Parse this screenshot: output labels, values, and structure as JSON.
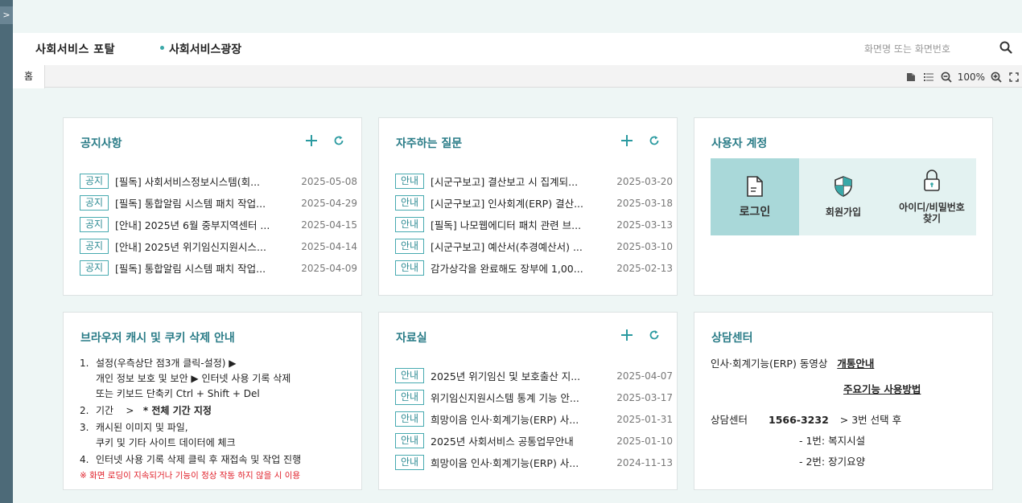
{
  "sidebar": {
    "toggle_icon": "chevron-right-icon",
    "toggle_label": ">"
  },
  "header": {
    "portal_title": "사회서비스 포탈",
    "menu_plaza": "사회서비스광장",
    "search_placeholder": "화면명 또는 화면번호",
    "search_icon": "search-icon"
  },
  "tabs": {
    "home": "홈",
    "zoom": "100%"
  },
  "notices": {
    "title": "공지사항",
    "items": [
      {
        "badge": "공지",
        "title": "[필독] 사회서비스정보시스템(회...",
        "date": "2025-05-08"
      },
      {
        "badge": "공지",
        "title": "[필독] 통합알림 시스템 패치 작업...",
        "date": "2025-04-29"
      },
      {
        "badge": "공지",
        "title": "[안내] 2025년 6월 중부지역센터 ...",
        "date": "2025-04-15"
      },
      {
        "badge": "공지",
        "title": "[안내] 2025년 위기임신지원시스...",
        "date": "2025-04-14"
      },
      {
        "badge": "공지",
        "title": "[필독] 통합알림 시스템 패치 작업...",
        "date": "2025-04-09"
      }
    ]
  },
  "faq": {
    "title": "자주하는 질문",
    "items": [
      {
        "badge": "안내",
        "title": "[시군구보고] 결산보고 시 집계되...",
        "date": "2025-03-20"
      },
      {
        "badge": "안내",
        "title": "[시군구보고] 인사회계(ERP) 결산...",
        "date": "2025-03-18"
      },
      {
        "badge": "안내",
        "title": "[필독] 나모웹에디터 패치 관련 브...",
        "date": "2025-03-13"
      },
      {
        "badge": "안내",
        "title": "[시군구보고] 예산서(추경예산서) ...",
        "date": "2025-03-10"
      },
      {
        "badge": "안내",
        "title": "감가상각을 완료해도 장부에 1,00...",
        "date": "2025-02-13"
      }
    ]
  },
  "account": {
    "title": "사용자 계정",
    "login": "로그인",
    "signup": "회원가입",
    "find_line1": "아이디/비밀번호",
    "find_line2": "찾기"
  },
  "cache_guide": {
    "title": "브라우저 캐시 및 쿠키 삭제 안내",
    "step1_num": "1.",
    "step1_a": "설정(우측상단 점3개 클릭-설정) ▶",
    "step1_b": "개인 정보 보호 및 보안 ▶ 인터넷 사용 기록 삭제",
    "step1_c": "또는 키보드 단축키 Ctrl + Shift + Del",
    "step2_num": "2.",
    "step2_a": "기간",
    "step2_b": ">",
    "step2_c": "* 전체 기간 지정",
    "step3_num": "3.",
    "step3_a": "캐시된 이미지 및 파일,",
    "step3_b": "쿠키 및 기타 사이트 데이터에 체크",
    "step4_num": "4.",
    "step4_a": "인터넷 사용 기록 삭제 클릭 후 재접속 및 작업 진행",
    "warning": "※ 화면 로딩이 지속되거나 기능이 정상 작동 하지 않을 시 이용"
  },
  "library": {
    "title": "자료실",
    "items": [
      {
        "badge": "안내",
        "title": "2025년 위기임신 및 보호출산 지...",
        "date": "2025-04-07"
      },
      {
        "badge": "안내",
        "title": "위기임신지원시스템 통계 기능 안...",
        "date": "2025-03-17"
      },
      {
        "badge": "안내",
        "title": "희망이음 인사·회계기능(ERP) 사...",
        "date": "2025-01-31"
      },
      {
        "badge": "안내",
        "title": "2025년 사회서비스 공통업무안내",
        "date": "2025-01-10"
      },
      {
        "badge": "안내",
        "title": "희망이음 인사·회계기능(ERP) 사...",
        "date": "2024-11-13"
      }
    ]
  },
  "consult": {
    "title": "상담센터",
    "erp_video": "인사·회계기능(ERP) 동영상",
    "link_open": "개통안내",
    "link_usage": "주요기능 사용방법",
    "center_label": "상담센터",
    "phone": "1566-3232",
    "select3": "> 3번 선택 후",
    "opt1": "- 1번: 복지시설",
    "opt2": "- 2번: 장기요양"
  },
  "colors": {
    "accent": "#2a7c87",
    "badge": "#47aab0",
    "sidebar": "#4d6a78",
    "tile_active": "#a9d8d9",
    "tile": "#e3f2f1",
    "warning": "#e0202a"
  }
}
